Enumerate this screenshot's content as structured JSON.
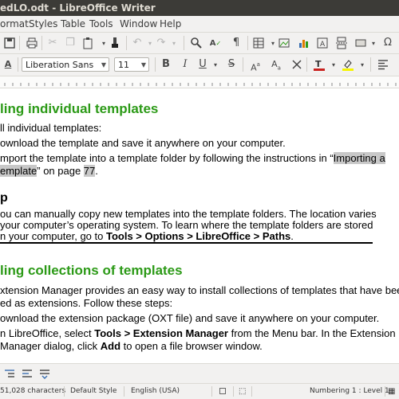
{
  "window": {
    "title": "edLO.odt - LibreOffice Writer"
  },
  "menu": [
    "ormat",
    "Styles",
    "Table",
    "Tools",
    "Window",
    "Help"
  ],
  "toolbar": {
    "font_name": "Liberation Sans",
    "font_size": "11",
    "font_color": "#c9211e",
    "highlight_color": "#f5f500"
  },
  "document": {
    "heading1": "ling individual templates",
    "intro": "ll individual templates:",
    "step1": "ownload the template and save it anywhere on your computer.",
    "step2_line1_a": "mport the template into a template folder by following the instructions in “",
    "step2_line1_link": "Importing a",
    "step2_line2_link": "emplate",
    "step2_line2_b": "” on page ",
    "step2_line2_page": "77",
    "step2_line2_end": ".",
    "tip_heading": "p",
    "tip_line1": "ou can manually copy new templates into the template folders. The location varies",
    "tip_line2": "your computer’s operating system. To learn where the template folders are stored",
    "tip_line3_a": "n your computer, go to ",
    "tip_line3_b": "Tools > Options > LibreOffice > Paths",
    "tip_line3_c": ".",
    "heading2": "ling collections of templates",
    "ext_line1": "xtension Manager provides an easy way to install collections of templates that have been",
    "ext_line2": "ed as extensions. Follow these steps:",
    "ext_step1": "ownload the extension package (OXT file) and save it anywhere on your computer.",
    "ext_step2_a": "n LibreOffice, select ",
    "ext_step2_b": "Tools > Extension Manager",
    "ext_step2_c": " from the Menu bar. In the Extension",
    "ext_step2_line2_a": "Manager dialog, click ",
    "ext_step2_line2_b": "Add",
    "ext_step2_line2_c": " to open a file browser window."
  },
  "status": {
    "characters": "51,028 characters",
    "page_style": "Default Style",
    "language": "English (USA)",
    "list": "Numbering 1 : Level 1"
  }
}
